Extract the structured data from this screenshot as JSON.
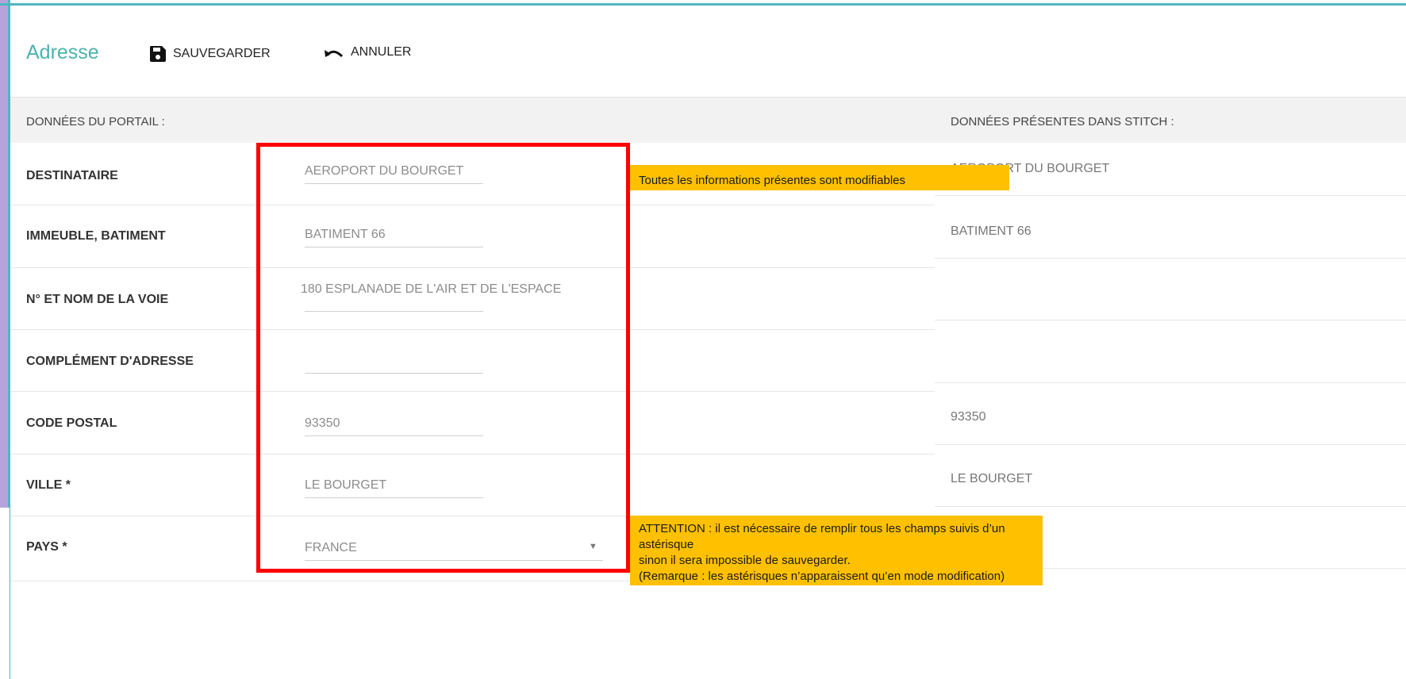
{
  "header": {
    "title": "Adresse",
    "save_label": "SAUVEGARDER",
    "cancel_label": "ANNULER"
  },
  "section": {
    "left_title": "DONNÉES DU PORTAIL :",
    "right_title": "DONNÉES PRÉSENTES DANS STITCH :"
  },
  "rows": [
    {
      "label": "DESTINATAIRE",
      "value": "AEROPORT DU BOURGET",
      "stitch_value": "AEROPORT DU BOURGET"
    },
    {
      "label": "IMMEUBLE, BATIMENT",
      "value": "BATIMENT 66",
      "stitch_value": "BATIMENT 66"
    },
    {
      "label": "N° ET NOM DE LA VOIE",
      "value": "180 ESPLANADE DE L'AIR ET DE L'ESPACE",
      "stitch_value": ""
    },
    {
      "label": "COMPLÉMENT D'ADRESSE",
      "value": "",
      "stitch_value": ""
    },
    {
      "label": "CODE POSTAL",
      "value": "93350",
      "stitch_value": "93350"
    },
    {
      "label": "VILLE *",
      "value": "LE BOURGET",
      "stitch_value": "LE BOURGET"
    },
    {
      "label": "PAYS *",
      "value": "FRANCE",
      "stitch_value": ""
    }
  ],
  "callouts": {
    "editable_note": "Toutes les informations présentes sont modifiables",
    "attention_line1": "ATTENTION : il est nécessaire de remplir tous les champs suivis d’un astérisque",
    "attention_line2": "sinon il sera impossible de sauvegarder.",
    "attention_line3": "(Remarque : les astérisques n’apparaissent qu’en mode modification)"
  },
  "colors": {
    "accent": "#4cb3ac",
    "highlight_border": "#ff0000",
    "callout_bg": "#ffc000"
  },
  "icons": {
    "save": "floppy-disk-icon",
    "cancel": "undo-arrow-icon",
    "dropdown": "caret-down-icon"
  }
}
